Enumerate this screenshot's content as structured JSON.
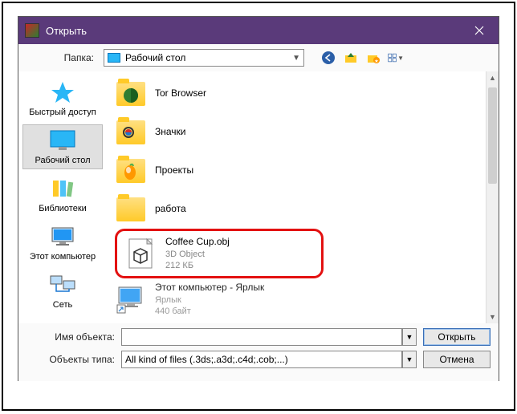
{
  "window": {
    "title": "Открыть"
  },
  "toolbar": {
    "folder_label": "Папка:",
    "folder_value": "Рабочий стол"
  },
  "sidebar": {
    "items": [
      {
        "label": "Быстрый доступ"
      },
      {
        "label": "Рабочий стол"
      },
      {
        "label": "Библиотеки"
      },
      {
        "label": "Этот компьютер"
      },
      {
        "label": "Сеть"
      }
    ]
  },
  "files": {
    "items": [
      {
        "name": "Tor Browser",
        "type": "",
        "size": ""
      },
      {
        "name": "Значки",
        "type": "",
        "size": ""
      },
      {
        "name": "Проекты",
        "type": "",
        "size": ""
      },
      {
        "name": "работа",
        "type": "",
        "size": ""
      },
      {
        "name": "Coffee Cup.obj",
        "type": "3D Object",
        "size": "212 КБ"
      },
      {
        "name": "Этот компьютер - Ярлык",
        "type": "Ярлык",
        "size": "440 байт"
      }
    ]
  },
  "bottom": {
    "name_label": "Имя объекта:",
    "name_value": "",
    "type_label": "Объекты типа:",
    "type_value": "All kind of files (.3ds;.a3d;.c4d;.cob;...)",
    "open_btn": "Открыть",
    "cancel_btn": "Отмена"
  }
}
